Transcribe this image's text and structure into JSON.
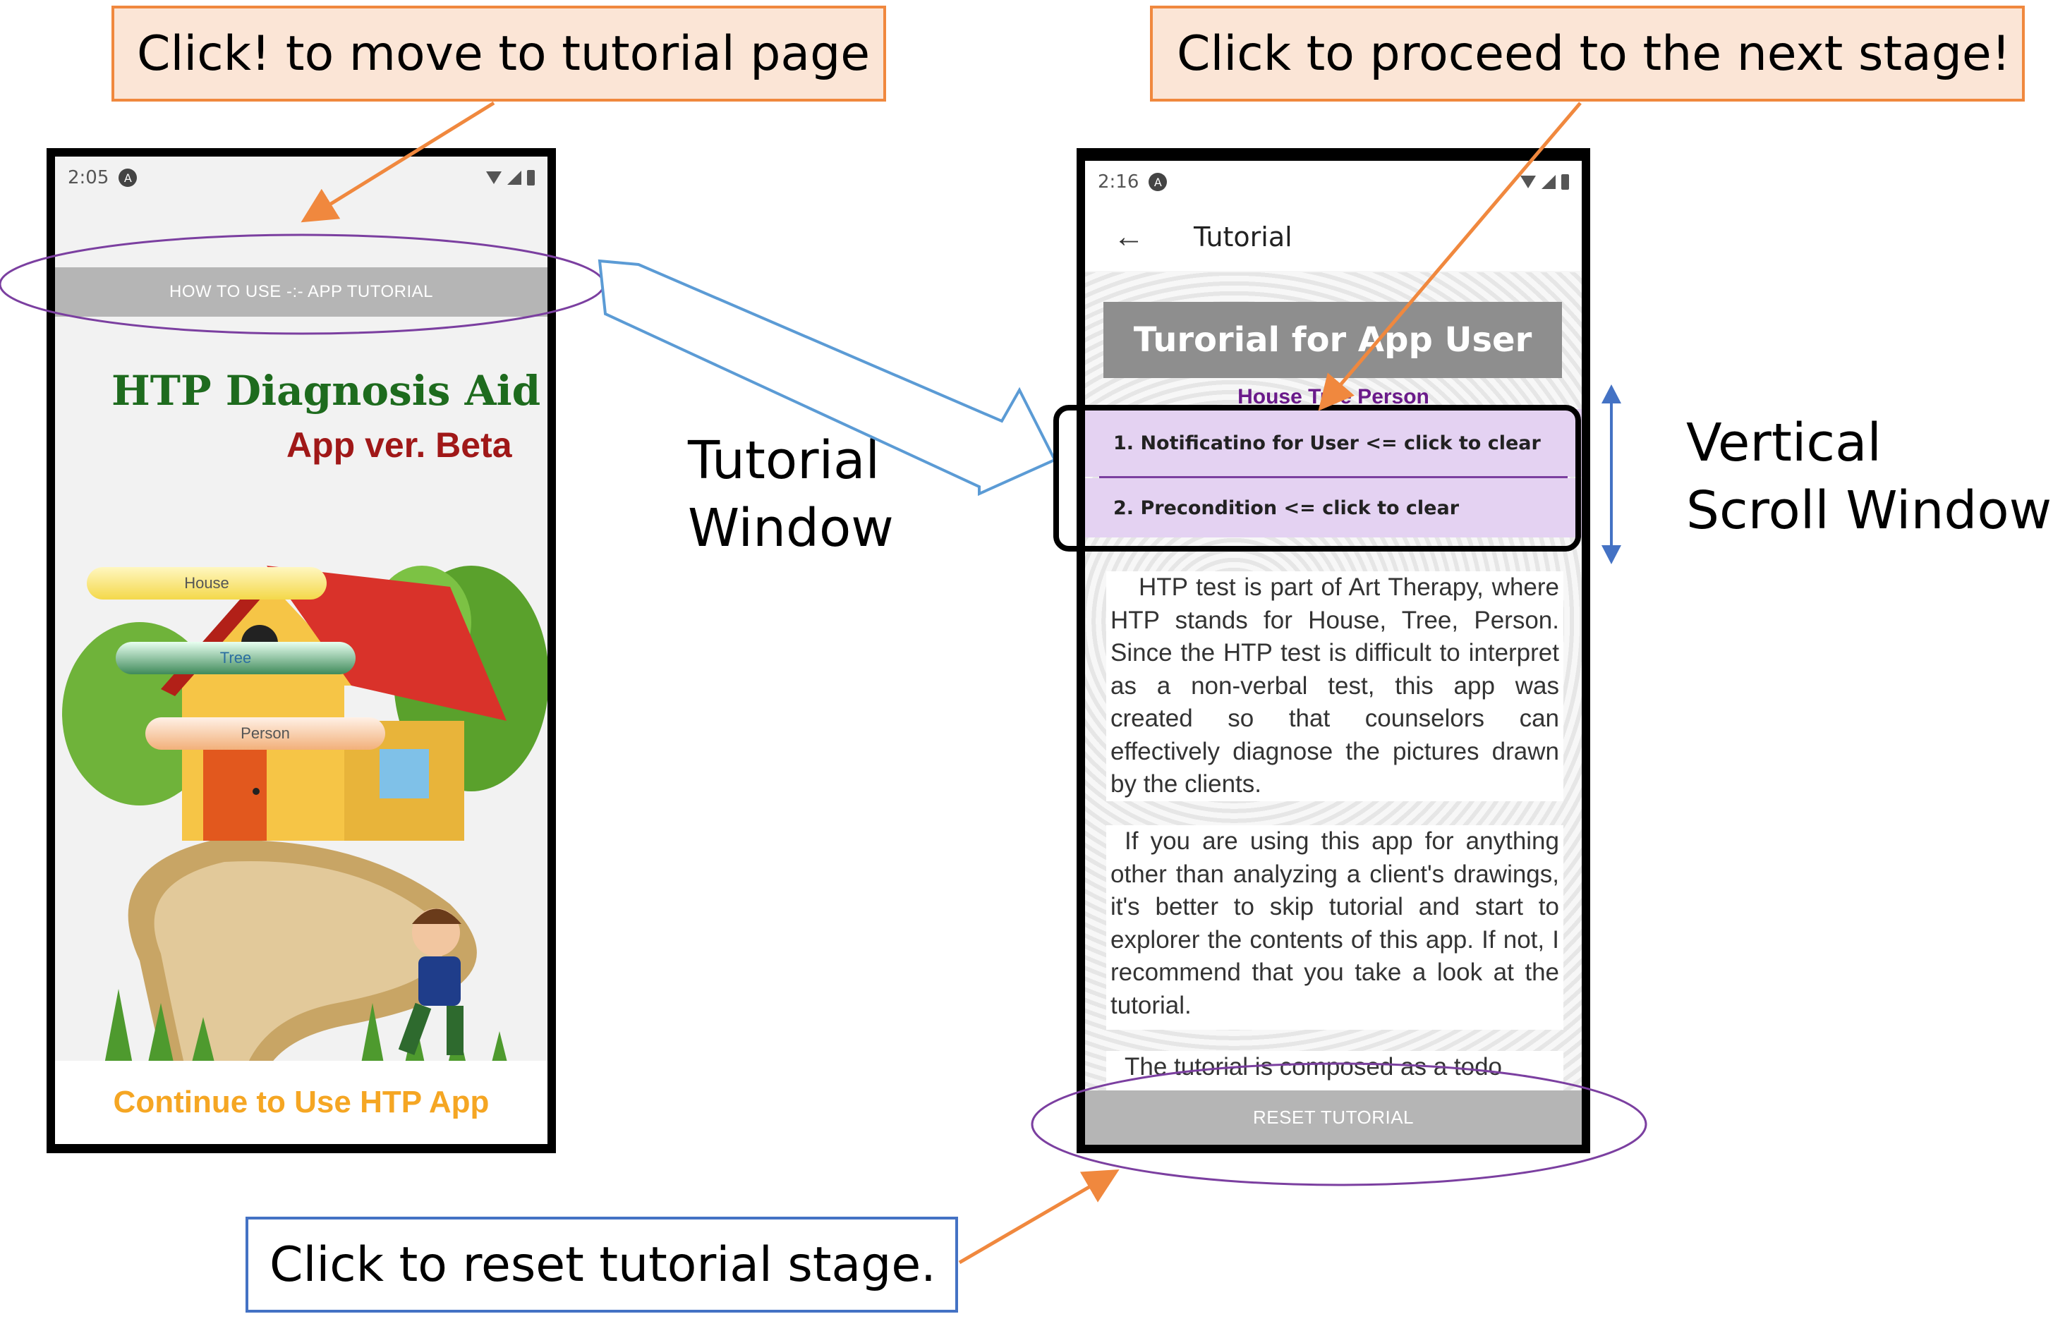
{
  "callouts": {
    "tutorial_page": "Click! to move to tutorial page",
    "next_stage": "Click to proceed to the next stage!",
    "reset_stage": "Click to reset tutorial stage."
  },
  "labels": {
    "tutorial_window_line1": "Tutorial",
    "tutorial_window_line2": "Window",
    "scroll_window_line1": "Vertical",
    "scroll_window_line2": "Scroll Window"
  },
  "home_screen": {
    "status_time": "2:05",
    "status_badge": "A",
    "tutorial_button": "HOW TO USE -:- APP TUTORIAL",
    "app_title": "HTP Diagnosis Aid",
    "app_version": "App ver. Beta",
    "menu_items": [
      "House",
      "Tree",
      "Person"
    ],
    "continue_button": "Continue to Use HTP App"
  },
  "tutorial_screen": {
    "status_time": "2:16",
    "status_badge": "A",
    "toolbar_title": "Tutorial",
    "banner": "Turorial for App User",
    "subheading": "House Tree Person",
    "todo_items": [
      "1. Notificatino for User <= click to clear",
      "2. Precondition <= click to clear"
    ],
    "paragraphs": [
      "HTP test is part of Art Therapy, where HTP stands for House, Tree, Person. Since the HTP test is difficult to interpret as a non-verbal test, this app was created so that counselors can effectively diagnose the pictures drawn by the clients.",
      "If you are using this app for anything other than analyzing a client's drawings, it's better to skip tutorial and start to explorer the contents of this app. If not, I recommend that you take a look at the tutorial.",
      "The tutorial is composed as a todo"
    ],
    "reset_button": "RESET TUTORIAL"
  },
  "colors": {
    "callout_border": "#f0883e",
    "callout_fill": "#fbe5d6",
    "accent_purple": "#7b3fa0",
    "arrow_blue": "#5b9bd5"
  }
}
